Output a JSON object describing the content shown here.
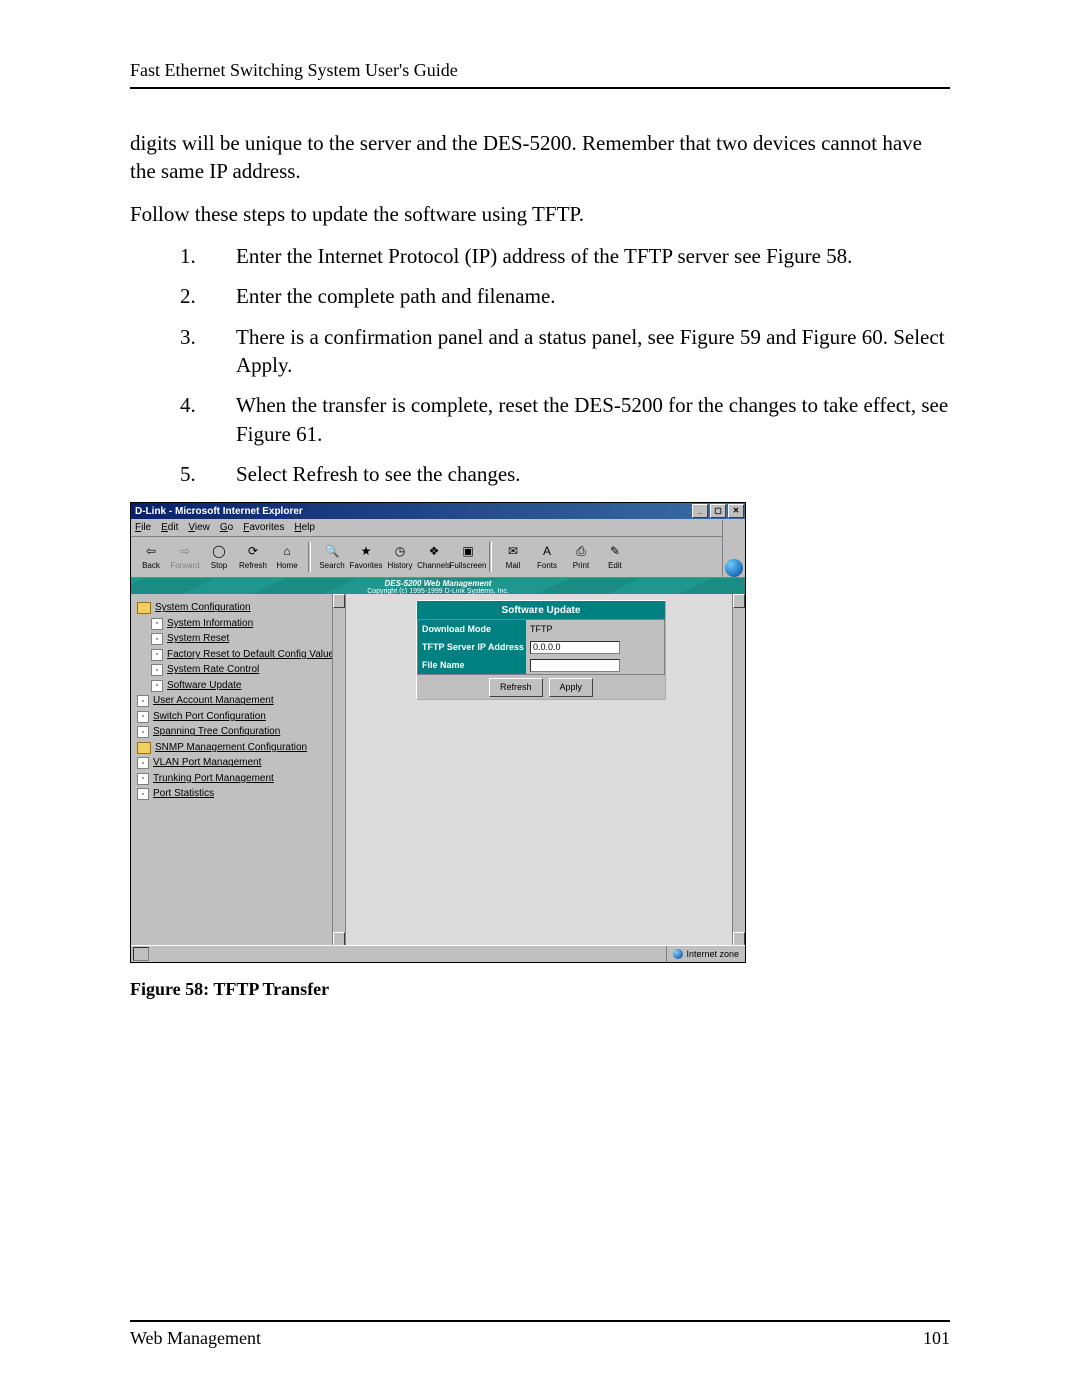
{
  "header": "Fast Ethernet Switching System User's Guide",
  "para1": "digits will be unique to the server and the DES-5200. Remember that two devices cannot have the same IP address.",
  "para2": "Follow these steps to update the software using TFTP.",
  "steps": [
    {
      "n": "1.",
      "t": "Enter the Internet Protocol (IP) address of the TFTP server see Figure 58."
    },
    {
      "n": "2.",
      "t": "Enter the complete path and filename."
    },
    {
      "n": "3.",
      "t": "There is a confirmation panel and a status panel, see Figure 59 and Figure 60. Select Apply."
    },
    {
      "n": "4.",
      "t": "When the transfer is complete, reset the DES-5200 for the changes to take effect, see Figure 61."
    },
    {
      "n": "5.",
      "t": "Select Refresh to see the changes."
    }
  ],
  "ie": {
    "title": "D-Link - Microsoft Internet Explorer",
    "menus": [
      "File",
      "Edit",
      "View",
      "Go",
      "Favorites",
      "Help"
    ],
    "toolbar": [
      {
        "name": "back",
        "label": "Back",
        "glyph": "⇦",
        "dis": false
      },
      {
        "name": "forward",
        "label": "Forward",
        "glyph": "⇨",
        "dis": true
      },
      {
        "name": "stop",
        "label": "Stop",
        "glyph": "◯",
        "dis": false
      },
      {
        "name": "refresh",
        "label": "Refresh",
        "glyph": "⟳",
        "dis": false
      },
      {
        "name": "home",
        "label": "Home",
        "glyph": "⌂",
        "dis": false
      },
      {
        "sep": true
      },
      {
        "name": "search",
        "label": "Search",
        "glyph": "🔍",
        "dis": false
      },
      {
        "name": "favorites",
        "label": "Favorites",
        "glyph": "★",
        "dis": false
      },
      {
        "name": "history",
        "label": "History",
        "glyph": "◷",
        "dis": false
      },
      {
        "name": "channels",
        "label": "Channels",
        "glyph": "❖",
        "dis": false
      },
      {
        "name": "fullscreen",
        "label": "Fullscreen",
        "glyph": "▣",
        "dis": false
      },
      {
        "sep": true
      },
      {
        "name": "mail",
        "label": "Mail",
        "glyph": "✉",
        "dis": false
      },
      {
        "name": "fonts",
        "label": "Fonts",
        "glyph": "A",
        "dis": false
      },
      {
        "name": "print",
        "label": "Print",
        "glyph": "⎙",
        "dis": false
      },
      {
        "name": "edit",
        "label": "Edit",
        "glyph": "✎",
        "dis": false
      }
    ],
    "band1": "DES-5200 Web Management",
    "band2": "Copyright (c) 1995-1999 D-Link Systems, Inc.",
    "tree": [
      {
        "type": "folder",
        "label": "System Configuration",
        "ind": 0
      },
      {
        "type": "doc",
        "label": "System Information",
        "ind": 1
      },
      {
        "type": "doc",
        "label": "System Reset",
        "ind": 1
      },
      {
        "type": "doc",
        "label": "Factory Reset to Default Config Values",
        "ind": 1
      },
      {
        "type": "doc",
        "label": "System Rate Control",
        "ind": 1
      },
      {
        "type": "doc",
        "label": "Software Update",
        "ind": 1
      },
      {
        "type": "doc",
        "label": "User Account Management",
        "ind": 0
      },
      {
        "type": "doc",
        "label": "Switch Port Configuration",
        "ind": 0
      },
      {
        "type": "doc",
        "label": "Spanning Tree Configuration",
        "ind": 0
      },
      {
        "type": "folder",
        "label": "SNMP Management Configuration",
        "ind": 0
      },
      {
        "type": "doc",
        "label": "VLAN Port Management",
        "ind": 0
      },
      {
        "type": "doc",
        "label": "Trunking Port Management",
        "ind": 0
      },
      {
        "type": "doc",
        "label": "Port Statistics",
        "ind": 0
      }
    ],
    "panel": {
      "title": "Software Update",
      "rows": [
        {
          "label": "Download Mode",
          "value": "TFTP",
          "input": false
        },
        {
          "label": "TFTP Server IP Address",
          "value": "0.0.0.0",
          "input": true
        },
        {
          "label": "File Name",
          "value": "",
          "input": true
        }
      ],
      "refresh": "Refresh",
      "apply": "Apply"
    },
    "status_zone": "Internet zone"
  },
  "caption": "Figure 58: TFTP Transfer",
  "footer_left": "Web Management",
  "footer_right": "101"
}
